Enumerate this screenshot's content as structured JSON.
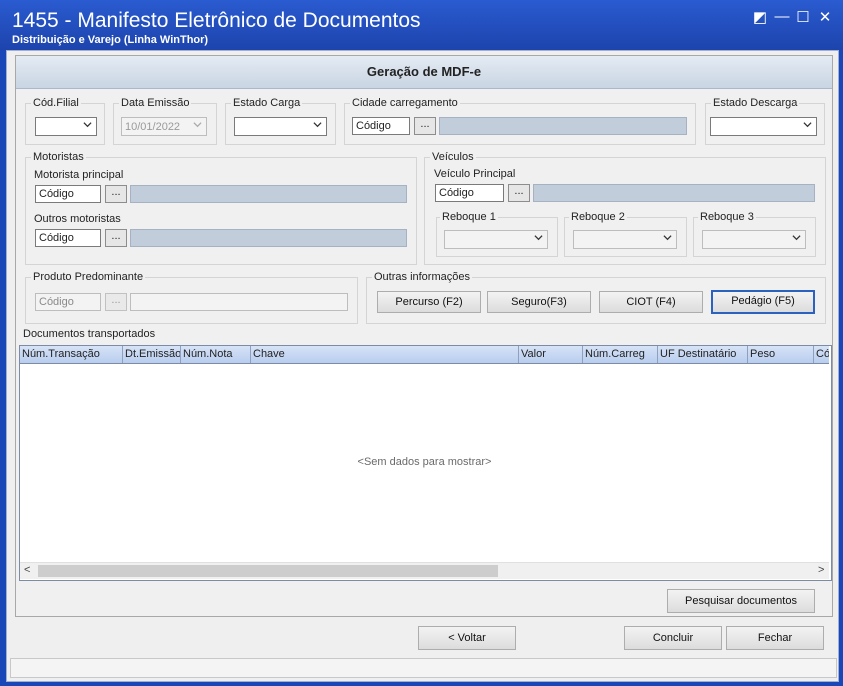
{
  "window": {
    "title": "1455 - Manifesto Eletrônico de Documentos",
    "subtitle": "Distribuição e Varejo (Linha WinThor)",
    "controls": {
      "restore": "◩",
      "minimize": "—",
      "maximize": "☐",
      "close": "✕"
    }
  },
  "header": {
    "title": "Geração de MDF-e"
  },
  "fields": {
    "cod_filial": {
      "label": "Cód.Filial",
      "value": ""
    },
    "data_emissao": {
      "label": "Data Emissão",
      "value": "10/01/2022"
    },
    "estado_carga": {
      "label": "Estado Carga",
      "value": ""
    },
    "cidade_carregamento": {
      "label": "Cidade carregamento",
      "placeholder": "Código",
      "ellipsis": "..."
    },
    "estado_descarga": {
      "label": "Estado Descarga",
      "value": ""
    }
  },
  "motoristas": {
    "group_label": "Motoristas",
    "principal_label": "Motorista principal",
    "principal_placeholder": "Código",
    "outros_label": "Outros motoristas",
    "outros_placeholder": "Código",
    "ellipsis": "..."
  },
  "veiculos": {
    "group_label": "Veículos",
    "principal_label": "Veículo Principal",
    "principal_placeholder": "Código",
    "ellipsis": "...",
    "reboque1": "Reboque 1",
    "reboque2": "Reboque 2",
    "reboque3": "Reboque 3"
  },
  "produto": {
    "label": "Produto Predominante",
    "placeholder": "Código",
    "ellipsis": "..."
  },
  "outras": {
    "label": "Outras informações",
    "percurso": "Percurso (F2)",
    "seguro": "Seguro(F3)",
    "ciot": "CIOT (F4)",
    "pedagio": "Pedágio (F5)"
  },
  "documentos": {
    "label": "Documentos transportados",
    "columns": [
      "Núm.Transação",
      "Dt.Emissão",
      "Núm.Nota",
      "Chave",
      "Valor",
      "Núm.Carreg",
      "UF Destinatário",
      "Peso",
      "Có"
    ],
    "empty_text": "<Sem dados para mostrar>",
    "scroll_left": "<",
    "scroll_right": ">"
  },
  "actions": {
    "pesquisar": "Pesquisar documentos",
    "voltar": "< Voltar",
    "concluir": "Concluir",
    "fechar": "Fechar"
  },
  "colors": {
    "titlebar": "#1d44ad",
    "header": "#c9d5e3",
    "grid_header": "#b8cdee",
    "readonly": "#c2cddb"
  }
}
